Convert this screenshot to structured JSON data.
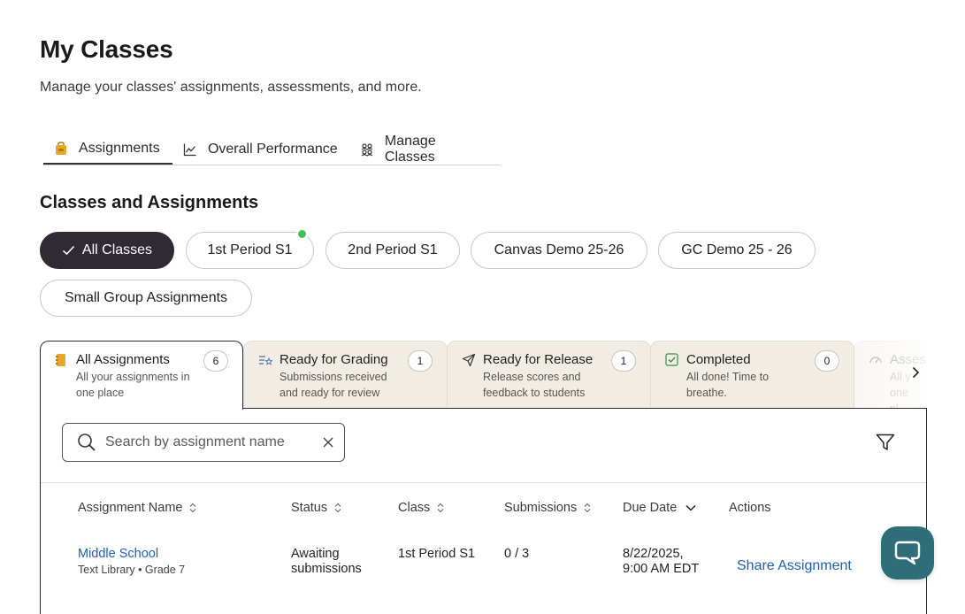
{
  "page": {
    "title": "My Classes",
    "subtitle": "Manage your classes' assignments, assessments, and more."
  },
  "main_tabs": [
    {
      "label": "Assignments",
      "icon": "backpack-icon",
      "active": true
    },
    {
      "label": "Overall Performance",
      "icon": "line-chart-icon",
      "active": false
    },
    {
      "label": "Manage Classes",
      "icon": "people-group-icon",
      "active": false
    }
  ],
  "section": {
    "title": "Classes and Assignments"
  },
  "class_chips": [
    {
      "label": "All Classes",
      "active": true
    },
    {
      "label": "1st Period S1",
      "active": false,
      "has_notification": true
    },
    {
      "label": "2nd Period S1",
      "active": false
    },
    {
      "label": "Canvas Demo 25-26",
      "active": false
    },
    {
      "label": "GC Demo 25 - 26",
      "active": false
    },
    {
      "label": "Small Group Assignments",
      "active": false
    }
  ],
  "status_tabs": [
    {
      "title": "All Assignments",
      "desc1": "All your assignments in",
      "desc2": "one place",
      "count": "6",
      "icon": "notebook-icon",
      "active": true
    },
    {
      "title": "Ready for Grading",
      "desc1": "Submissions received",
      "desc2": "and ready for review",
      "count": "1",
      "icon": "grading-list-icon",
      "active": false
    },
    {
      "title": "Ready for Release",
      "desc1": "Release scores and",
      "desc2": "feedback to students",
      "count": "1",
      "icon": "send-icon",
      "active": false
    },
    {
      "title": "Completed",
      "desc1": "All done! Time to",
      "desc2": "breathe.",
      "count": "0",
      "icon": "check-square-icon",
      "active": false
    },
    {
      "title": "Asses",
      "desc1": "All y",
      "desc2": "one pl",
      "count": "",
      "icon": "gauge-icon",
      "active": false
    }
  ],
  "search": {
    "placeholder": "Search by assignment name",
    "value": ""
  },
  "table": {
    "headers": [
      "Assignment Name",
      "Status",
      "Class",
      "Submissions",
      "Due Date",
      "Actions"
    ],
    "rows": [
      {
        "name": "Middle School",
        "meta": "Text Library • Grade 7",
        "status_line1": "Awaiting",
        "status_line2": "submissions",
        "class": "1st Period S1",
        "submissions": "0 / 3",
        "due_line1": "8/22/2025,",
        "due_line2": "9:00 AM EDT",
        "action": "Share Assignment"
      }
    ]
  },
  "colors": {
    "chip_active_bg": "#2f2a33",
    "link": "#1f5fae",
    "tab_inactive_bg": "#f1ede4",
    "notification_dot": "#3fbf56",
    "chat_fab": "#2f6e78",
    "assignments_icon": "#e6a82a"
  }
}
